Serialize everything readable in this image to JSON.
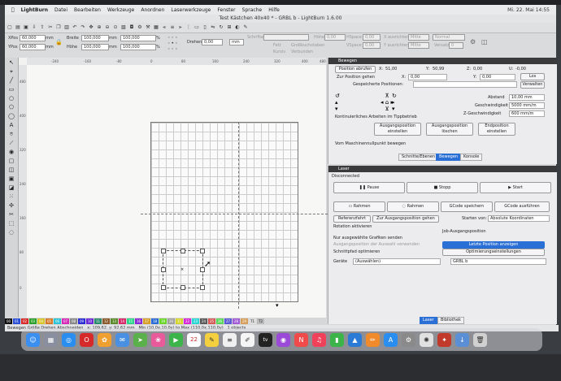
{
  "menubar": {
    "items": [
      "LightBurn",
      "Datei",
      "Bearbeiten",
      "Werkzeuge",
      "Anordnen",
      "Laserwerkzeuge",
      "Fenster",
      "Sprache",
      "Hilfe"
    ],
    "clock": "Mi. 22. Mai 14:55"
  },
  "window": {
    "title": "Test Kästchen 40x40 * - GRBL b - LightBurn 1.6.00"
  },
  "props": {
    "xpos_label": "XPos",
    "xpos_value": "60,000",
    "ypos_label": "YPos",
    "ypos_value": "60,000",
    "width_label": "Breite",
    "width_value": "100,000",
    "height_label": "Höhe",
    "height_value": "100,000",
    "unit": "mm",
    "pct_w": "100,000",
    "pct_h": "100,000",
    "pct_sym": "%",
    "rotate_label": "Drehen",
    "rotate_value": "0,00",
    "font_label": "Schriftart",
    "size_label": "Höhe",
    "size_value": "0,00",
    "hspace_label": "HSpace",
    "hspace_value": "0,00",
    "vspace_label": "VSpace",
    "vspace_value": "0,00",
    "halign_label": "X ausrichten",
    "halign_value": "Mitte",
    "valign_label": "Y ausrichten",
    "valign_value": "Mitte",
    "normal": "Normal",
    "offset_label": "Versatz",
    "offset_value": "0",
    "bold": "Fett",
    "italic": "Kursiv",
    "caps": "Großbuchstaben",
    "welded": "Verbunden"
  },
  "ruler_top": [
    "-240",
    "-160",
    "-80",
    "0",
    "80",
    "160",
    "240",
    "320",
    "400",
    "480"
  ],
  "ruler_left": [
    "480",
    "400",
    "320",
    "240",
    "160",
    "80",
    "0"
  ],
  "palette": [
    "00",
    "01",
    "02",
    "03",
    "04",
    "05",
    "06",
    "07",
    "08",
    "09",
    "10",
    "11",
    "12",
    "13",
    "14",
    "15",
    "16",
    "17",
    "18",
    "19",
    "20",
    "21",
    "22",
    "23",
    "24",
    "25",
    "26",
    "27",
    "28",
    "29",
    "T1",
    "T2"
  ],
  "palette_colors": [
    "#111",
    "#2a4fd6",
    "#d62a2a",
    "#2aa02a",
    "#d6c42a",
    "#d67a2a",
    "#2ac4d6",
    "#d62ab8",
    "#888",
    "#2a2ad6",
    "#6b2ad6",
    "#2a8a6b",
    "#8a5a2a",
    "#5a8a2a",
    "#d62a6b",
    "#2ad68a",
    "#8a2ad6",
    "#d6a02a",
    "#2a6bd6",
    "#6bd62a",
    "#a0a0a0",
    "#d6d62a",
    "#d62ad6",
    "#2ad6d6",
    "#5a5a5a",
    "#d65a5a",
    "#5ad65a",
    "#5a5ad6",
    "#a05ad6",
    "#d6a05a",
    "#ddd",
    "#bbb"
  ],
  "statusbar": {
    "move": "Bewegen",
    "size": "Größe",
    "rotate": "Drehen",
    "shear": "Abschneiden",
    "coords": "x: 109,62, y: 92,62 mm",
    "range": "Min (10,0x,10,0y) to Max (110,0x,110,0y)",
    "objects": "1 objects"
  },
  "move_panel": {
    "title": "Bewegen",
    "get_position": "Position abrufen",
    "x_label": "X:",
    "x_value": "51,00",
    "y_label": "Y:",
    "y_value": "50,99",
    "z_label": "Z:",
    "z_value": "0,00",
    "u_label": "U:",
    "u_value": "-0,00",
    "goto_label": "Zur Position gehen",
    "goto_x_label": "X:",
    "goto_x_value": "0,00",
    "goto_y_label": "Y:",
    "goto_y_value": "0,00",
    "go_button": "Los",
    "saved_label": "Gespeicherte Positionen:",
    "manage_button": "Verwalten",
    "distance_label": "Abstand",
    "distance_value": "10,00 mm",
    "speed_label": "Geschwindigkeit",
    "speed_value": "5000 mm/m",
    "zspeed_label": "Z-Geschwindigkeit",
    "zspeed_value": "600 mm/m",
    "continuous": "Kontinuierliches Arbeiten im Tippbetrieb",
    "set_origin": "Ausgangsposition einstellen",
    "clear_origin": "Ausgangsposition löschen",
    "set_end": "Endposition einstellen",
    "from_machine_zero": "Vom Maschinennullpunkt bewegen",
    "tabs": [
      "Schnitte/Ebenen",
      "Bewegen",
      "Konsole"
    ]
  },
  "laser_panel": {
    "title": "Laser",
    "status": "Disconnected",
    "pause": "Pause",
    "stop": "Stopp",
    "start": "Start",
    "frame1": "Rahmen",
    "frame2": "Rahmen",
    "save_gcode": "GCode speichern",
    "run_gcode": "GCode ausführen",
    "home": "Referenzfahrt",
    "goto_origin": "Zur Ausgangsposition gehen",
    "start_from_label": "Starten von:",
    "start_from_value": "Absolute Koordinaten",
    "rotary": "Rotation aktivieren",
    "job_origin": "Job-Ausgangsposition",
    "cut_selected": "Nur ausgewählte Grafiken senden",
    "use_selection_origin": "Ausgangsposition der Auswahl verwenden",
    "show_last_position": "Letzte Position anzeigen",
    "optimize": "Schnittpfad optimieren",
    "opt_settings": "Optimierungseinstellungen",
    "devices_label": "Geräte",
    "devices_value": "(Auswählen)",
    "device_value": "GRBL b",
    "tabs": [
      "Laser",
      "Bibliothek"
    ]
  },
  "dock": {
    "icons": [
      {
        "name": "finder",
        "color": "#3b8ff0",
        "glyph": "☺"
      },
      {
        "name": "launchpad",
        "color": "#8a8fa0",
        "glyph": "▦"
      },
      {
        "name": "safari",
        "color": "#2a8df0",
        "glyph": "◎"
      },
      {
        "name": "opera",
        "color": "#d62a2a",
        "glyph": "O"
      },
      {
        "name": "photos-app",
        "color": "#f0a030",
        "glyph": "✿"
      },
      {
        "name": "mail",
        "color": "#4a90e2",
        "glyph": "✉"
      },
      {
        "name": "maps",
        "color": "#5ab04a",
        "glyph": "➤"
      },
      {
        "name": "photos",
        "color": "#e85a9a",
        "glyph": "❀"
      },
      {
        "name": "facetime",
        "color": "#3cb44a",
        "glyph": "▶"
      },
      {
        "name": "calendar",
        "color": "#ffffff",
        "glyph": "22"
      },
      {
        "name": "notes",
        "color": "#f4d03f",
        "glyph": "✎"
      },
      {
        "name": "reminders",
        "color": "#f0f0f0",
        "glyph": "≡"
      },
      {
        "name": "freeform",
        "color": "#f5f5f5",
        "glyph": "✐"
      },
      {
        "name": "apple-tv",
        "color": "#222222",
        "glyph": "tv"
      },
      {
        "name": "podcasts",
        "color": "#9a4ad6",
        "glyph": "◉"
      },
      {
        "name": "news",
        "color": "#f04a4a",
        "glyph": "N"
      },
      {
        "name": "music",
        "color": "#f0405a",
        "glyph": "♫"
      },
      {
        "name": "numbers",
        "color": "#3cb44a",
        "glyph": "▮"
      },
      {
        "name": "keynote",
        "color": "#2a7ad6",
        "glyph": "▲"
      },
      {
        "name": "pages",
        "color": "#f08a2a",
        "glyph": "✏"
      },
      {
        "name": "app-store",
        "color": "#2a8df0",
        "glyph": "A"
      },
      {
        "name": "system-settings",
        "color": "#8a8a8a",
        "glyph": "⚙"
      },
      {
        "name": "chatgpt",
        "color": "#e0e0e0",
        "glyph": "✺"
      },
      {
        "name": "lightburn",
        "color": "#c0392b",
        "glyph": "✦"
      },
      {
        "name": "downloads",
        "color": "#5a8fd6",
        "glyph": "↓"
      },
      {
        "name": "trash",
        "color": "#d0d0d0",
        "glyph": "🗑"
      }
    ]
  }
}
